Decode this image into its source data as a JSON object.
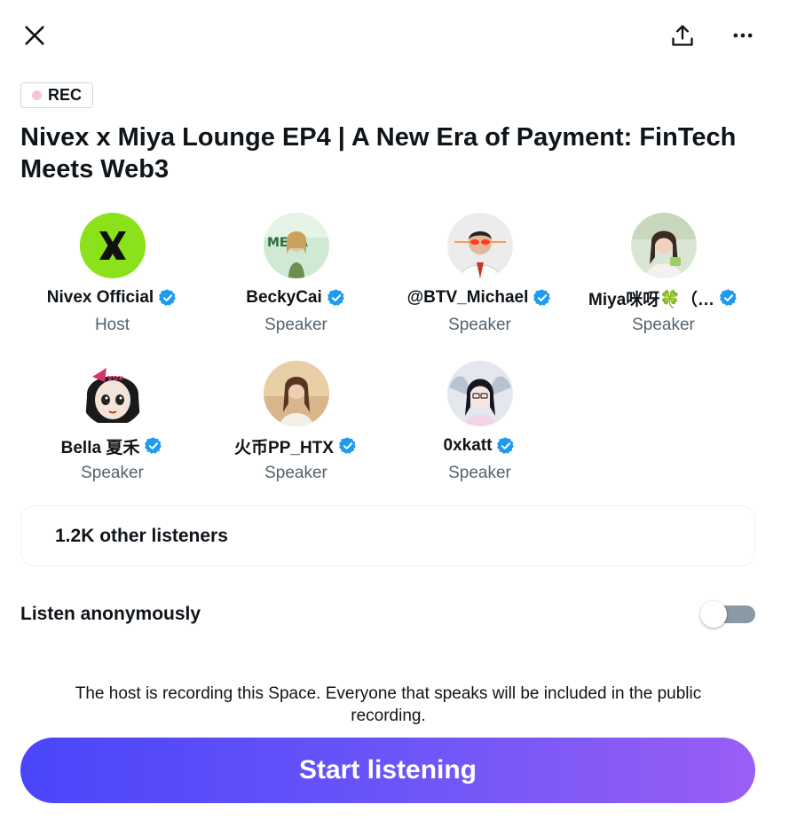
{
  "header": {
    "close_icon": "close-icon",
    "share_icon": "share-icon",
    "more_icon": "more-icon"
  },
  "badge": {
    "label": "REC",
    "dot_color": "#f7c4d6"
  },
  "space": {
    "title": "Nivex x Miya Lounge EP4 | A New Era of Payment: FinTech Meets Web3"
  },
  "participants": [
    {
      "name": "Nivex Official",
      "role": "Host",
      "verified": true,
      "avatar": "nivex-logo-avatar"
    },
    {
      "name": "BeckyCai",
      "role": "Speaker",
      "verified": true,
      "avatar": "photo-avatar"
    },
    {
      "name": "@BTV_Michael",
      "role": "Speaker",
      "verified": true,
      "avatar": "photo-avatar"
    },
    {
      "name": "Miya咪呀🍀（…",
      "role": "Speaker",
      "verified": true,
      "avatar": "photo-avatar"
    },
    {
      "name": "Bella 夏禾",
      "role": "Speaker",
      "verified": true,
      "avatar": "cartoon-avatar"
    },
    {
      "name": "火币PP_HTX",
      "role": "Speaker",
      "verified": true,
      "avatar": "photo-avatar"
    },
    {
      "name": "0xkatt",
      "role": "Speaker",
      "verified": true,
      "avatar": "anime-avatar"
    }
  ],
  "listeners": {
    "text": "1.2K other listeners"
  },
  "anonymous": {
    "label": "Listen anonymously",
    "enabled": false
  },
  "notice": {
    "text": "The host is recording this Space. Everyone that speaks will be included in the public recording."
  },
  "cta": {
    "label": "Start listening"
  },
  "colors": {
    "verified": "#1d9bf0",
    "secondary_text": "#536471",
    "gradient_start": "#4a45fb",
    "gradient_end": "#9a5ef5"
  }
}
